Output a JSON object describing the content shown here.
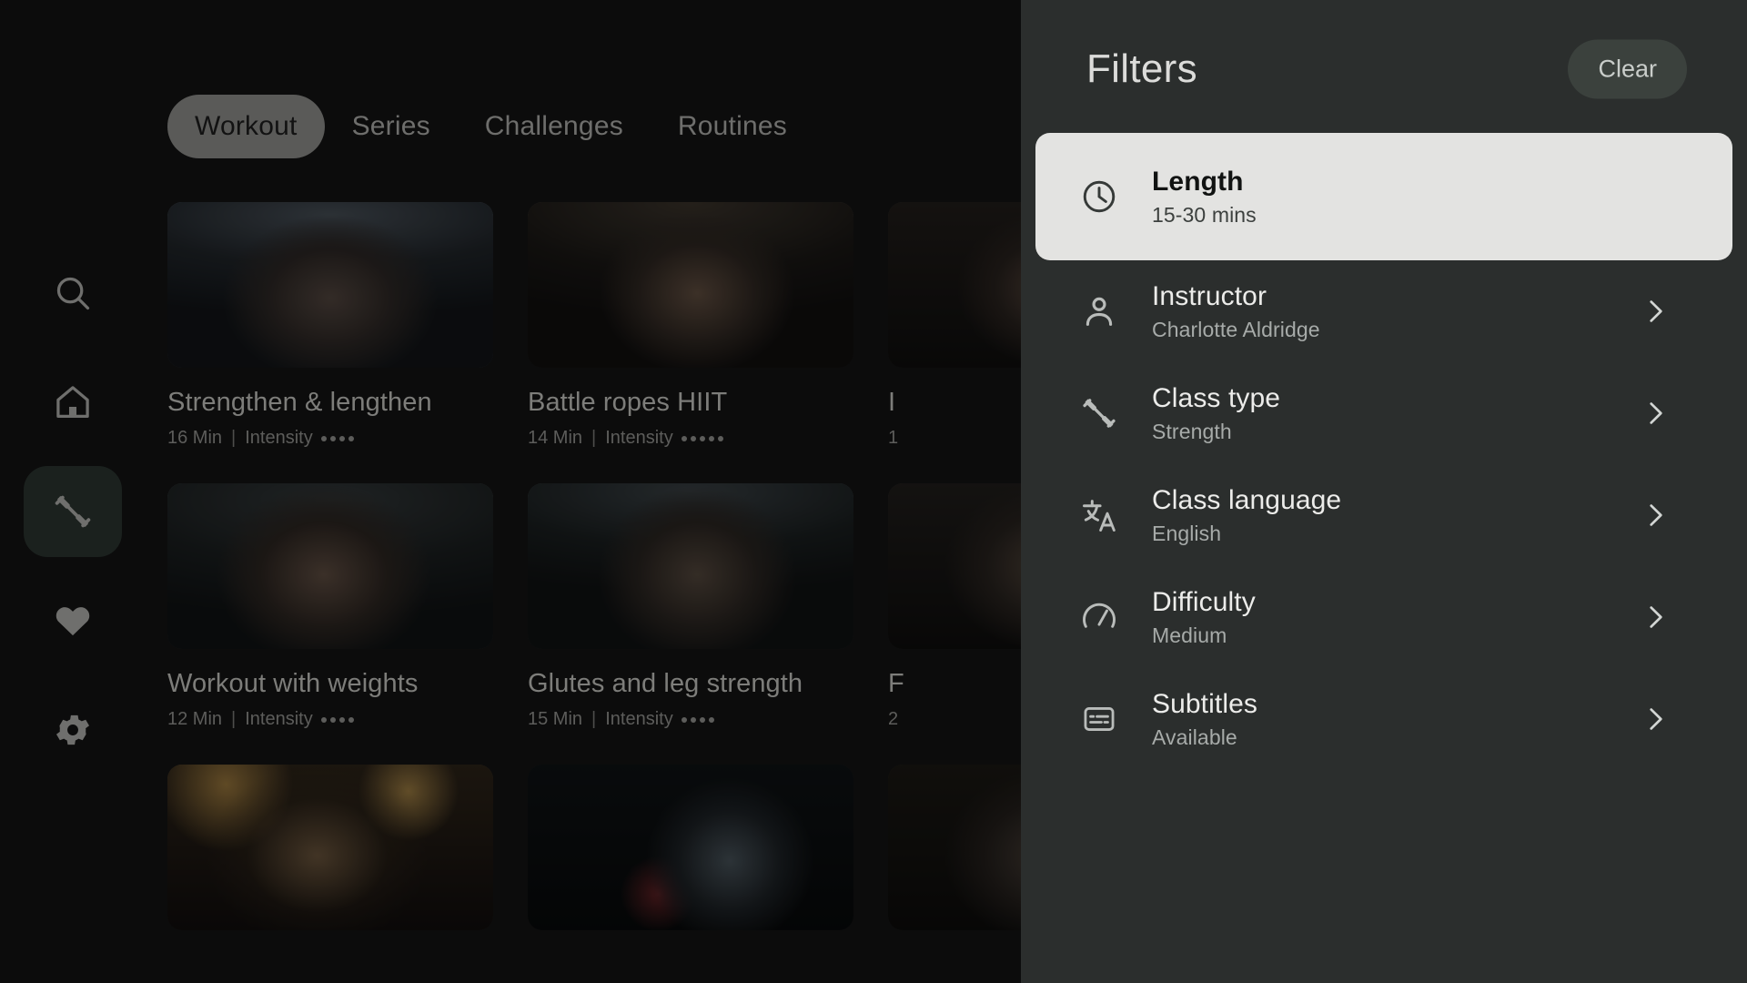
{
  "sidebar": {
    "items": [
      {
        "name": "search",
        "icon": "search-icon",
        "active": false
      },
      {
        "name": "home",
        "icon": "home-icon",
        "active": false
      },
      {
        "name": "workouts",
        "icon": "dumbbell-icon",
        "active": true
      },
      {
        "name": "favorites",
        "icon": "heart-icon",
        "active": false
      },
      {
        "name": "settings",
        "icon": "gear-icon",
        "active": false
      }
    ]
  },
  "main": {
    "tabs": [
      {
        "label": "Workout",
        "active": true
      },
      {
        "label": "Series",
        "active": false
      },
      {
        "label": "Challenges",
        "active": false
      },
      {
        "label": "Routines",
        "active": false
      }
    ],
    "cards": [
      {
        "title": "Strengthen & lengthen",
        "duration": "16 Min",
        "intensity_label": "Intensity",
        "intensity": 4
      },
      {
        "title": "Battle ropes HIIT",
        "duration": "14 Min",
        "intensity_label": "Intensity",
        "intensity": 5
      },
      {
        "title": "I",
        "duration": "1",
        "intensity_label": "",
        "intensity": 0
      },
      {
        "title": "Workout with weights",
        "duration": "12 Min",
        "intensity_label": "Intensity",
        "intensity": 4
      },
      {
        "title": "Glutes and leg strength",
        "duration": "15 Min",
        "intensity_label": "Intensity",
        "intensity": 4
      },
      {
        "title": "F",
        "duration": "2",
        "intensity_label": "",
        "intensity": 0
      },
      {
        "title": "",
        "duration": "",
        "intensity_label": "",
        "intensity": 0
      },
      {
        "title": "",
        "duration": "",
        "intensity_label": "",
        "intensity": 0
      },
      {
        "title": "",
        "duration": "",
        "intensity_label": "",
        "intensity": 0
      }
    ]
  },
  "panel": {
    "title": "Filters",
    "clear_label": "Clear",
    "filters": [
      {
        "label": "Length",
        "value": "15-30 mins",
        "icon": "clock-icon",
        "selected": true,
        "chevron": false
      },
      {
        "label": "Instructor",
        "value": "Charlotte Aldridge",
        "icon": "person-icon",
        "selected": false,
        "chevron": true
      },
      {
        "label": "Class type",
        "value": "Strength",
        "icon": "dumbbell-icon",
        "selected": false,
        "chevron": true
      },
      {
        "label": "Class language",
        "value": "English",
        "icon": "translate-icon",
        "selected": false,
        "chevron": true
      },
      {
        "label": "Difficulty",
        "value": "Medium",
        "icon": "gauge-icon",
        "selected": false,
        "chevron": true
      },
      {
        "label": "Subtitles",
        "value": "Available",
        "icon": "subtitles-icon",
        "selected": false,
        "chevron": true
      }
    ]
  },
  "colors": {
    "app_bg": "#0c0c0c",
    "panel_bg": "#2b2e2d",
    "selected_card_bg": "#e3e3e1",
    "active_tab_bg": "#5a5a58",
    "clear_btn_bg": "#3b413d",
    "rail_active_bg": "#1b211e"
  }
}
